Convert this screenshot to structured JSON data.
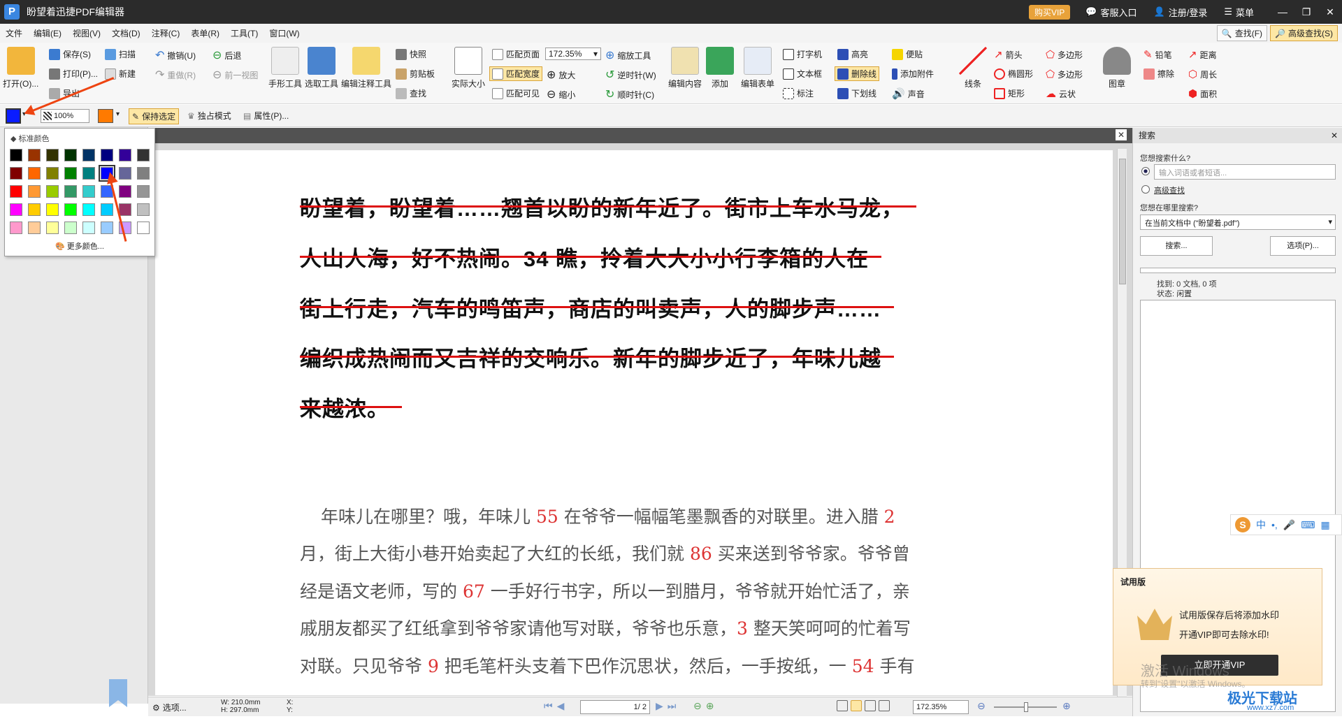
{
  "app": {
    "title": "盼望着迅捷PDF编辑器",
    "logo_letter": "P"
  },
  "titlebar": {
    "vip": "购买VIP",
    "service": "客服入口",
    "login": "注册/登录",
    "menu": "菜单",
    "minimize": "—",
    "restore": "❐",
    "close": "✕"
  },
  "menu": [
    "文件",
    "编辑(E)",
    "视图(V)",
    "文档(D)",
    "注释(C)",
    "表单(R)",
    "工具(T)",
    "窗口(W)"
  ],
  "menu_right": {
    "find": "查找(F)",
    "advanced_find": "高级查找(S)"
  },
  "ribbon": {
    "open": "打开(O)...",
    "save": "保存(S)",
    "print": "打印(P)...",
    "export": "导出",
    "scan": "扫描",
    "new": "新建",
    "undo": "撤销(U)",
    "redo": "重做(R)",
    "back": "后退",
    "prev_view": "前一视图",
    "hand": "手形工具",
    "select_text": "选取工具",
    "edit_annot": "编辑注释工具",
    "snapshot": "快照",
    "clipboard": "剪贴板",
    "find": "查找",
    "actual_size": "实际大小",
    "fit_page": "匹配页面",
    "fit_width": "匹配宽度",
    "fit_visible": "匹配可见",
    "zoom_value": "172.35%",
    "zoom_in": "放大",
    "zoom_out": "缩小",
    "zoom_tool": "缩放工具",
    "ccw": "逆时针(W)",
    "cw": "顺时针(C)",
    "edit_content": "编辑内容",
    "add": "添加",
    "edit_form": "编辑表单",
    "typewriter": "打字机",
    "textbox": "文本框",
    "callout": "标注",
    "highlight": "高亮",
    "strikeout": "删除线",
    "underline": "下划线",
    "note": "便贴",
    "attach": "添加附件",
    "sound": "声音",
    "line": "线条",
    "arrow": "箭头",
    "ellipse": "椭圆形",
    "rect": "矩形",
    "polygon": "多边形",
    "polyline": "多边形",
    "cloud": "云状",
    "stamp": "图章",
    "pencil": "铅笔",
    "eraser": "擦除",
    "distance": "距离",
    "perimeter": "周长",
    "area": "面积"
  },
  "toolbar2": {
    "opacity": "100%",
    "keep_selected": "保持选定",
    "exclusive": "独占模式",
    "properties": "属性(P)..."
  },
  "color_popup": {
    "header": "标准颜色",
    "more": "更多颜色...",
    "selected_index": 13,
    "colors": [
      "#000000",
      "#993300",
      "#333300",
      "#003300",
      "#003366",
      "#000080",
      "#330099",
      "#333333",
      "#800000",
      "#ff6600",
      "#808000",
      "#008000",
      "#008080",
      "#0000ff",
      "#666699",
      "#808080",
      "#ff0000",
      "#ff9933",
      "#99cc00",
      "#339966",
      "#33cccc",
      "#3366ff",
      "#800080",
      "#969696",
      "#ff00ff",
      "#ffcc00",
      "#ffff00",
      "#00ff00",
      "#00ffff",
      "#00ccff",
      "#993366",
      "#c0c0c0",
      "#ff99cc",
      "#ffcc99",
      "#ffff99",
      "#ccffcc",
      "#ccffff",
      "#99ccff",
      "#cc99ff",
      "#ffffff"
    ]
  },
  "document": {
    "strike_lines": [
      "盼望着，盼望着……翘首以盼的新年近了。街市上车水马龙，",
      "人山人海，好不热闹。34 瞧，拎着大大小小行李箱的人在",
      "街上行走，汽车的鸣笛声，商店的叫卖声，人的脚步声……",
      "编织成热闹而又吉祥的交响乐。新年的脚步近了，年味儿越",
      "来越浓。"
    ],
    "paragraph": [
      [
        " 年味儿在哪里？哦，年味儿 ",
        "55",
        " 在爷爷一幅幅笔墨飘香的对联里。进入腊 ",
        "2",
        ""
      ],
      [
        "月，街上大街小巷开始卖起了大红的长纸，我们就 ",
        "86",
        " 买来送到爷爷家。爷爷曾",
        "",
        ""
      ],
      [
        "经是语文老师，写的 ",
        "67",
        " 一手好行书字，所以一到腊月，爷爷就开始忙活了，亲",
        "",
        ""
      ],
      [
        "戚朋友都买了红纸拿到爷爷家请他写对联，爷爷也乐意，",
        "3",
        " 整天笑呵呵的忙着写",
        "",
        ""
      ],
      [
        "对联。只见爷爷 ",
        "9",
        " 把毛笔杆头支着下巴作沉思状，然后，一手按纸，一 ",
        "54",
        " 手有"
      ]
    ]
  },
  "statusbar": {
    "options": "选项...",
    "width": "W: 210.0mm",
    "height": "H: 297.0mm",
    "x": "X:",
    "y": "Y:",
    "page": "1",
    "page_total": "/ 2",
    "zoom": "172.35%"
  },
  "search_panel": {
    "title": "搜索",
    "what": "您想搜索什么?",
    "placeholder": "输入词语或者短语...",
    "advanced": "高级查找",
    "where": "您想在哪里搜索?",
    "scope": "在当前文档中 (\"盼望着.pdf\")",
    "search_btn": "搜索...",
    "options_btn": "选项(P)...",
    "found": "找到: 0 文档, 0 项",
    "status": "状态: 闲置"
  },
  "trial": {
    "title": "试用版",
    "line1": "试用版保存后将添加水印",
    "line2": "开通VIP即可去除水印!",
    "button": "立即开通VIP"
  },
  "watermark": {
    "line1": "激活 Windows",
    "line2": "转到\"设置\"以激活 Windows。"
  },
  "site": {
    "name": "极光下载站",
    "url": "www.xz7.com"
  },
  "ime": {
    "lang": "中"
  },
  "colors": {
    "titlebar": "#2b2b2b",
    "accent": "#fde7a5",
    "strike": "#dd1111",
    "number": "#dd3333"
  }
}
